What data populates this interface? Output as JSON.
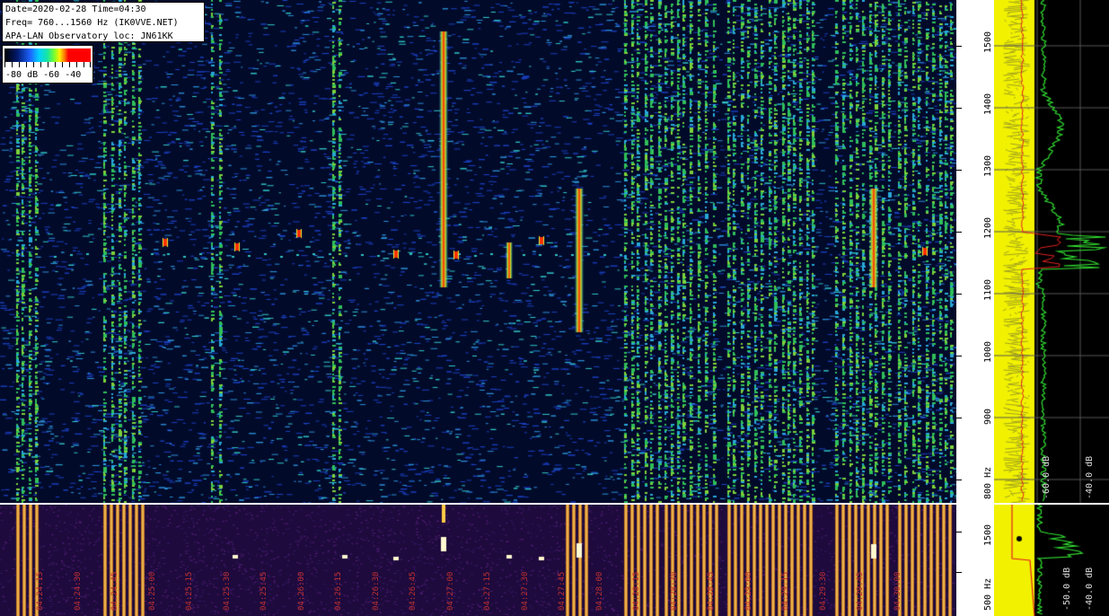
{
  "header": {
    "line1": "Date=2020-02-28 Time=04:30",
    "line2": "Freq= 760...1560 Hz (IK0VVE.NET)",
    "line3": "APA-LAN Observatory loc: JN61KK"
  },
  "legend": {
    "labels": "-80 dB -60    -40"
  },
  "frequency_axis": {
    "unit": "Hz",
    "labels": [
      "1500",
      "1400",
      "1300",
      "1200",
      "1100",
      "1000",
      "900",
      "800 Hz"
    ]
  },
  "frequency_axis_bottom": {
    "labels": [
      "1500",
      "500 Hz"
    ]
  },
  "spectrum_axis": {
    "labels": [
      "-60.0 dB",
      "-40.0 dB"
    ]
  },
  "spectrum_axis_bottom": {
    "labels": [
      "-50.0 dB",
      "-40.0 dB"
    ]
  },
  "time_axis": {
    "labels": [
      "04:24:15",
      "04:24:30",
      "04:24:45",
      "04:25:00",
      "04:25:15",
      "04:25:30",
      "04:25:45",
      "04:26:00",
      "04:26:15",
      "04:26:30",
      "04:26:45",
      "04:27:00",
      "04:27:15",
      "04:27:30",
      "04:27:45",
      "04:28:00",
      "04:28:15",
      "04:28:30",
      "04:28:45",
      "04:29:00",
      "04:29:15",
      "04:29:30",
      "04:29:45",
      "04:30:00"
    ]
  },
  "colors": {
    "scale_background": "#ffffff",
    "waterfall_background": "#020a2a",
    "secondary_waterfall_background": "#1e0a3c",
    "time_label_color": "#c03030"
  }
}
